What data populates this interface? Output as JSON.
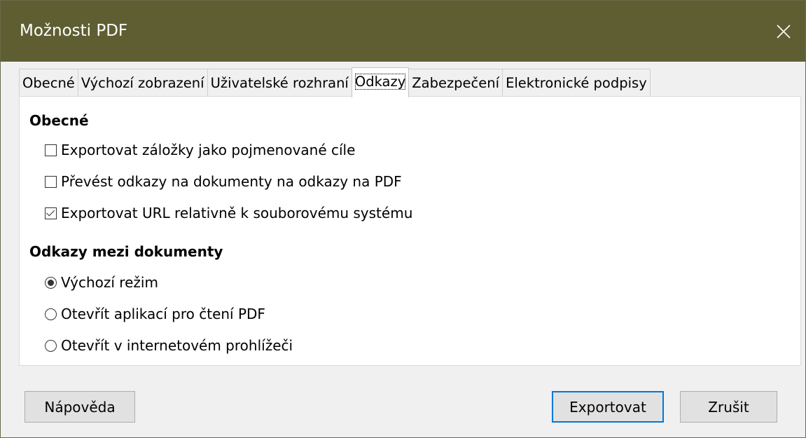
{
  "window": {
    "title": "Možnosti PDF"
  },
  "tabs": [
    {
      "label": "Obecné"
    },
    {
      "label": "Výchozí zobrazení"
    },
    {
      "label": "Uživatelské rozhraní"
    },
    {
      "label": "Odkazy",
      "active": true
    },
    {
      "label": "Zabezpečení"
    },
    {
      "label": "Elektronické podpisy"
    }
  ],
  "general": {
    "heading": "Obecné",
    "options": [
      {
        "label": "Exportovat záložky jako pojmenované cíle",
        "checked": false
      },
      {
        "label": "Převést odkazy na dokumenty na odkazy na PDF",
        "checked": false
      },
      {
        "label": "Exportovat URL relativně k souborovému systému",
        "checked": true
      }
    ]
  },
  "crossdoc": {
    "heading": "Odkazy mezi dokumenty",
    "options": [
      {
        "label": "Výchozí režim",
        "selected": true
      },
      {
        "label": "Otevřít aplikací pro čtení PDF",
        "selected": false
      },
      {
        "label": "Otevřít v internetovém prohlížeči",
        "selected": false
      }
    ]
  },
  "buttons": {
    "help": "Nápověda",
    "export": "Exportovat",
    "cancel": "Zrušit"
  },
  "colors": {
    "titlebar": "#5e5e32",
    "default_button_border": "#0078d7"
  }
}
